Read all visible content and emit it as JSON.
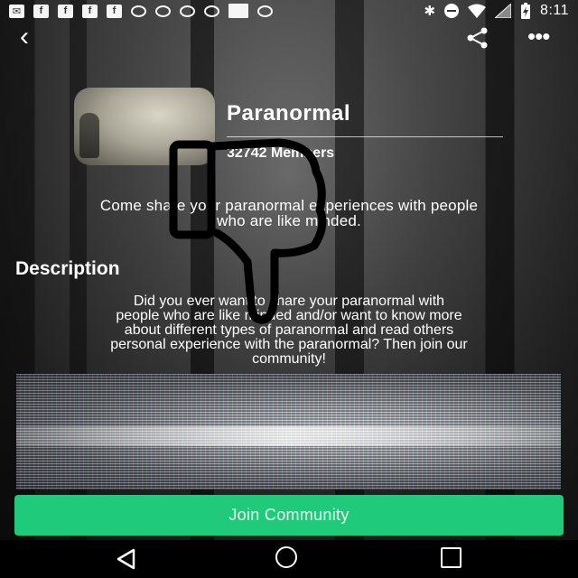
{
  "status_bar": {
    "time": "8:11",
    "left_icons": [
      "mail-icon",
      "facebook-icon",
      "facebook-icon",
      "facebook-icon",
      "facebook-icon",
      "voicemail-icon",
      "voicemail-icon",
      "voicemail-icon",
      "voicemail-icon",
      "square-icon",
      "voicemail-icon"
    ],
    "right_icons": [
      "bluetooth-icon",
      "do-not-disturb-icon",
      "wifi-icon",
      "signal-icon",
      "battery-charging-icon"
    ]
  },
  "appbar": {
    "back_icon": "back-arrow-icon",
    "share_icon": "share-icon",
    "more_icon": "more-options-icon"
  },
  "community": {
    "name": "Paranormal",
    "members": "32742 Members",
    "tagline_line1": "Come share your paranormal experiences with people",
    "tagline_line2": "who are like minded."
  },
  "description": {
    "heading": "Description",
    "lines": [
      "Did you ever want to share your paranormal with",
      "people who are like minded and/or want to know more",
      "about different types of paranormal and read others",
      "personal experience with the paranormal? Then join our",
      "community!"
    ]
  },
  "join_button": {
    "label": "Join Community",
    "color": "#1fcb7a"
  },
  "nav_bar": {
    "icons": [
      "nav-back-icon",
      "nav-home-icon",
      "nav-recents-icon"
    ]
  },
  "overlay": {
    "icon": "thumbs-down-icon"
  }
}
